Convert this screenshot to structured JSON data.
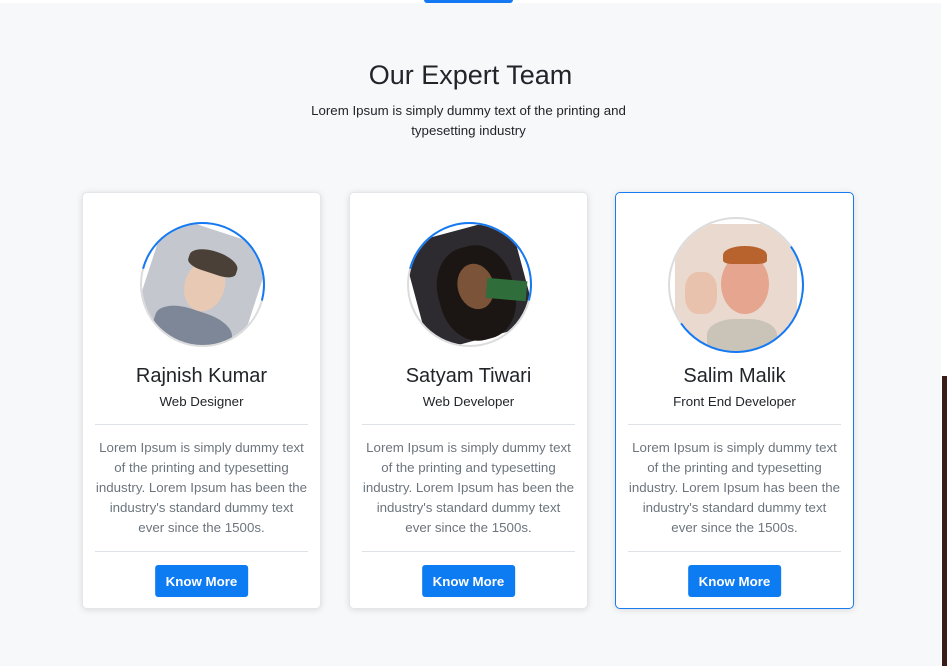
{
  "section": {
    "title": "Our Expert Team",
    "subtitle": "Lorem Ipsum is simply dummy text of the printing and typesetting industry"
  },
  "members": [
    {
      "name": "Rajnish Kumar",
      "role": "Web Designer",
      "description": "Lorem Ipsum is simply dummy text of the printing and typesetting industry. Lorem Ipsum has been the industry's standard dummy text ever since the 1500s.",
      "button": "Know More"
    },
    {
      "name": "Satyam Tiwari",
      "role": "Web Developer",
      "description": "Lorem Ipsum is simply dummy text of the printing and typesetting industry. Lorem Ipsum has been the industry's standard dummy text ever since the 1500s.",
      "button": "Know More"
    },
    {
      "name": "Salim Malik",
      "role": "Front End Developer",
      "description": "Lorem Ipsum is simply dummy text of the printing and typesetting industry. Lorem Ipsum has been the industry's standard dummy text ever since the 1500s.",
      "button": "Know More"
    }
  ],
  "colors": {
    "accent": "#0d7bf2",
    "background": "#f7f8fa",
    "card": "#ffffff",
    "muted_text": "#6c757d"
  }
}
